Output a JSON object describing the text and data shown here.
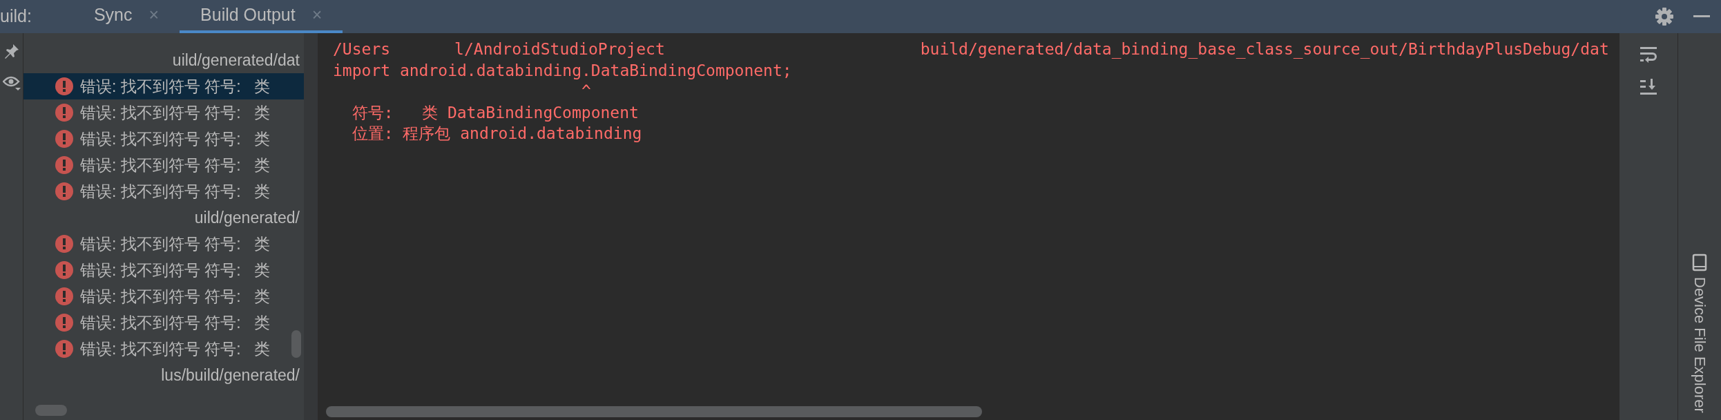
{
  "toolwindow": {
    "title": "uild:"
  },
  "tabs": [
    {
      "label": "Sync",
      "close": "×",
      "selected": false
    },
    {
      "label": "Build Output",
      "close": "×",
      "selected": true
    }
  ],
  "tree": {
    "rows": [
      {
        "kind": "path",
        "text": "uild/generated/dat",
        "selected": false
      },
      {
        "kind": "error",
        "text": "错误: 找不到符号 符号:   类",
        "selected": true
      },
      {
        "kind": "error",
        "text": "错误: 找不到符号 符号:   类",
        "selected": false
      },
      {
        "kind": "error",
        "text": "错误: 找不到符号 符号:   类",
        "selected": false
      },
      {
        "kind": "error",
        "text": "错误: 找不到符号 符号:   类",
        "selected": false
      },
      {
        "kind": "error",
        "text": "错误: 找不到符号 符号:   类",
        "selected": false
      },
      {
        "kind": "path",
        "text": "uild/generated/",
        "selected": false
      },
      {
        "kind": "error",
        "text": "错误: 找不到符号 符号:   类",
        "selected": false
      },
      {
        "kind": "error",
        "text": "错误: 找不到符号 符号:   类",
        "selected": false
      },
      {
        "kind": "error",
        "text": "错误: 找不到符号 符号:   类",
        "selected": false
      },
      {
        "kind": "error",
        "text": "错误: 找不到符号 符号:   类",
        "selected": false
      },
      {
        "kind": "error",
        "text": "错误: 找不到符号 符号:   类",
        "selected": false
      },
      {
        "kind": "path",
        "text": "lus/build/generated/",
        "selected": false
      }
    ]
  },
  "console": {
    "lines": [
      {
        "segments": [
          "/Users",
          "l/AndroidStudioProject",
          "build/generated/data_binding_base_class_source_out/BirthdayPlusDebug/dat"
        ]
      },
      {
        "segments": [
          "import android.databinding.DataBindingComponent;"
        ]
      },
      {
        "segments": [
          "                          ^"
        ]
      },
      {
        "segments": [
          "  符号:   类 DataBindingComponent"
        ]
      },
      {
        "segments": [
          "  位置: 程序包 android.databinding"
        ]
      }
    ]
  },
  "side_panel": {
    "label": "Device File Explorer"
  }
}
